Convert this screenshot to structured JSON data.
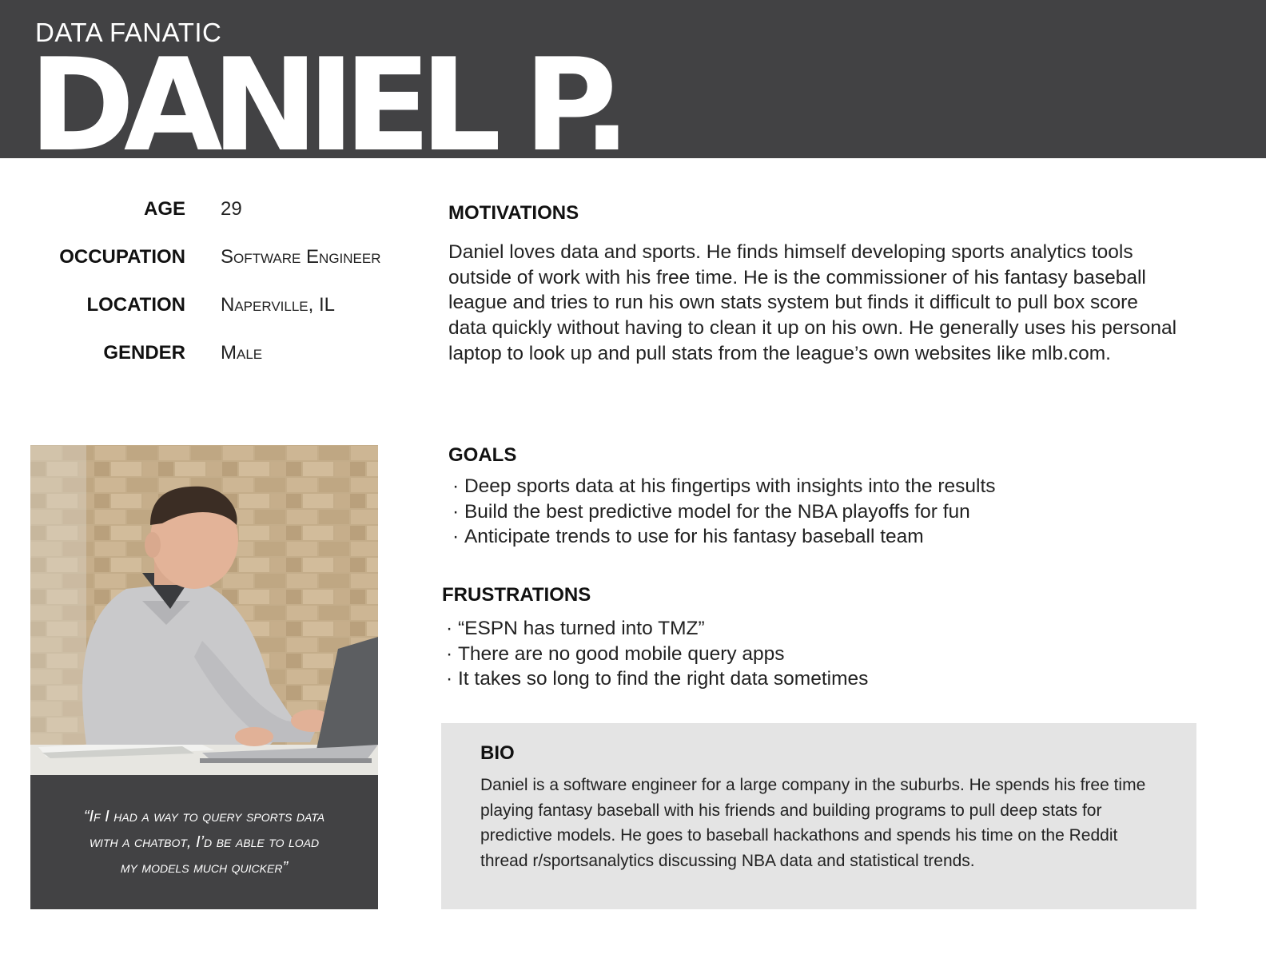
{
  "header": {
    "subtitle": "DATA FANATIC",
    "name": "DANIEL P."
  },
  "profile": {
    "fields": [
      {
        "label": "AGE",
        "value": "29"
      },
      {
        "label": "OCCUPATION",
        "value": "Software Engineer"
      },
      {
        "label": "LOCATION",
        "value": "Naperville, IL"
      },
      {
        "label": "GENDER",
        "value": "Male"
      }
    ]
  },
  "motivations": {
    "title": "MOTIVATIONS",
    "lines": [
      "Daniel loves data and sports.  He finds himself developing sports analytics tools",
      "outside of work with his free time.  He is the commissioner of his fantasy baseball",
      "league and tries to run his own stats system but finds it difficult to pull box score",
      "data quickly without having to clean it up on his own.  He generally uses his personal",
      "laptop to look up and pull stats from the league’s own websites like mlb.com."
    ]
  },
  "goals": {
    "title": "GOALS",
    "items": [
      "Deep sports data at his fingertips with insights into the results",
      "Build the best predictive model for the NBA playoffs for fun",
      "Anticipate trends to use for his fantasy baseball team"
    ]
  },
  "frustrations": {
    "title": "FRUSTRATIONS",
    "items": [
      "“ESPN has turned into TMZ”",
      "There are no good mobile query apps",
      "It takes so long to find the right data sometimes"
    ]
  },
  "quote": {
    "lines": [
      "“If I had a way to query sports data",
      "with a chatbot, I’d be able to load",
      "my models much quicker”"
    ]
  },
  "bio": {
    "title": "BIO",
    "lines": [
      "Daniel is a software engineer for a large company in the suburbs.  He spends his free time",
      "playing fantasy baseball with his friends and building programs to pull deep stats for",
      "predictive models.  He goes to baseball hackathons and spends his time on the Reddit",
      "thread r/sportsanalytics discussing NBA data and statistical trends."
    ]
  },
  "colors": {
    "header_bg": "#424244",
    "quote_bg": "#424244",
    "bio_bg": "#e4e4e4",
    "text": "#111111"
  }
}
